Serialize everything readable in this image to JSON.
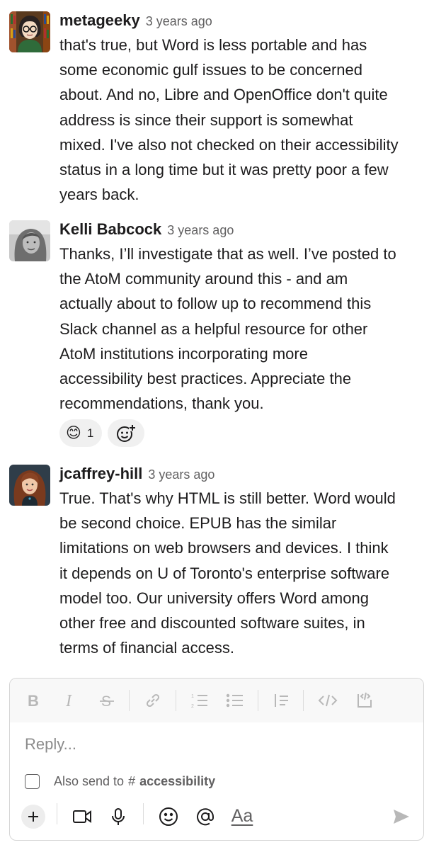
{
  "messages": [
    {
      "author": "metageeky",
      "time": "3 years ago",
      "lines": [
        "that's true, but Word is less portable and has",
        "some economic gulf issues to be concerned",
        "about. And no, Libre and OpenOffice don't quite",
        "address is since their support is somewhat",
        "mixed. I've also not checked on their accessibility",
        "status in a long time but it was pretty poor a few",
        "years back."
      ]
    },
    {
      "author": "Kelli Babcock",
      "time": "3 years ago",
      "lines": [
        "Thanks, I’ll investigate that as well. I’ve posted to",
        "the AtoM community around this - and am",
        "actually about to follow up to recommend this",
        "Slack channel as a helpful resource for other",
        "AtoM institutions incorporating more",
        "accessibility best practices. Appreciate the",
        "recommendations, thank you."
      ],
      "reaction": {
        "emoji": "😊",
        "count": "1"
      }
    },
    {
      "author": "jcaffrey-hill",
      "time": "3 years ago",
      "lines": [
        "True. That's why HTML is still better. Word would",
        "be second choice. EPUB has the similar",
        "limitations on web browsers and devices. I think",
        "it depends on U of Toronto's enterprise software",
        "model too. Our university offers Word among",
        "other free and discounted software suites, in",
        "terms of financial access."
      ]
    }
  ],
  "composer": {
    "placeholder": "Reply...",
    "also_send_label": "Also send to",
    "hash": "#",
    "channel": "accessibility",
    "aa_label": "Aa",
    "toolbar_icons": [
      "bold-icon",
      "italic-icon",
      "strikethrough-icon",
      "link-icon",
      "ordered-list-icon",
      "bulleted-list-icon",
      "blockquote-icon",
      "code-icon",
      "code-block-icon"
    ],
    "bottom_icons": [
      "plus-icon",
      "video-icon",
      "microphone-icon",
      "emoji-icon",
      "mention-icon",
      "formatting-icon",
      "send-icon"
    ]
  },
  "colors": {
    "text": "#1d1c1d",
    "muted": "#616061",
    "toolbar_bg": "#f8f8f8",
    "icon_disabled": "#b8b8b8"
  }
}
